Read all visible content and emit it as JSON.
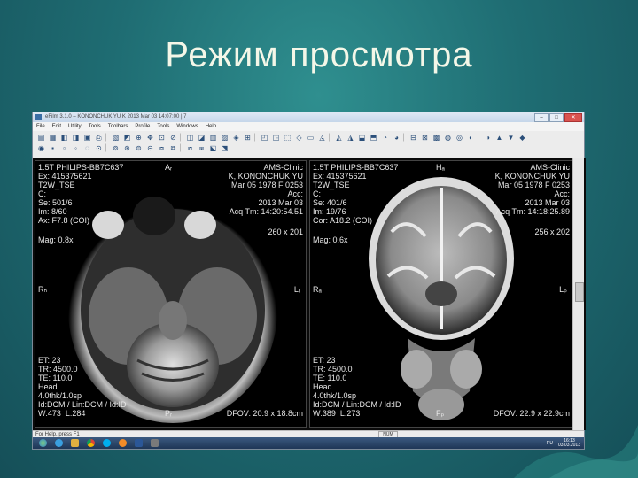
{
  "slide": {
    "title": "Режим просмотра"
  },
  "window": {
    "title": "eFilm 3.1.0 – KONONCHUK YU K 2013 Mar 03 14:07:00 | 7"
  },
  "menu": [
    "File",
    "Edit",
    "Utility",
    "Tools",
    "Toolbars",
    "Profile",
    "Tools",
    "Windows",
    "Help"
  ],
  "panes": {
    "left": {
      "tl": "1.5T PHILIPS-BB7C637\nEx: 415375621\nT2W_TSE\nC:\nSe: 501/6\nIm: 8/60\nAx: F7.8 (COI)",
      "mag": "Mag: 0.8x",
      "tr": "AMS-Clinic\nK, KONONCHUK YU\nMar 05 1978 F 0253\nAcc:\n2013 Mar 03\nAcq Tm: 14:20:54.51",
      "dim": "260 x 201",
      "bl": "ET: 23\nTR: 4500.0\nTE: 110.0\nHead\n4.0thk/1.0sp\nId:DCM / Lin:DCM / Id:ID\nW:473  L:284",
      "br": "DFOV: 20.9 x 18.8cm",
      "top_marker": "Aᵣ",
      "bottom_marker": "Pᵣ",
      "left_marker": "Rₕ",
      "right_marker": "Lᵣ"
    },
    "right": {
      "tl": "1.5T PHILIPS-BB7C637\nEx: 415375621\nT2W_TSE\nC:\nSe: 401/6\nIm: 19/76\nCor: A18.2 (COI)",
      "mag": "Mag: 0.6x",
      "tr": "AMS-Clinic\nK, KONONCHUK YU\nMar 05 1978 F 0253\nAcc:\n2013 Mar 03\nAcq Tm: 14:18:25.89",
      "dim": "256 x 202",
      "bl": "ET: 23\nTR: 4500.0\nTE: 110.0\nHead\n4.0thk/1.0sp\nId:DCM / Lin:DCM / Id:ID\nW:389  L:273",
      "br": "DFOV: 22.9 x 22.9cm",
      "top_marker": "Hₐ",
      "bottom_marker": "Fₚ",
      "left_marker": "Rₐ",
      "right_marker": "Lₚ"
    }
  },
  "status": {
    "text": "For Help, press F1",
    "num": "NUM"
  },
  "tray": {
    "lang": "RU",
    "time": "16:13",
    "date": "03.03.2013"
  },
  "colors": {
    "background": "#1f6d73",
    "title": "#f4f7e8"
  }
}
